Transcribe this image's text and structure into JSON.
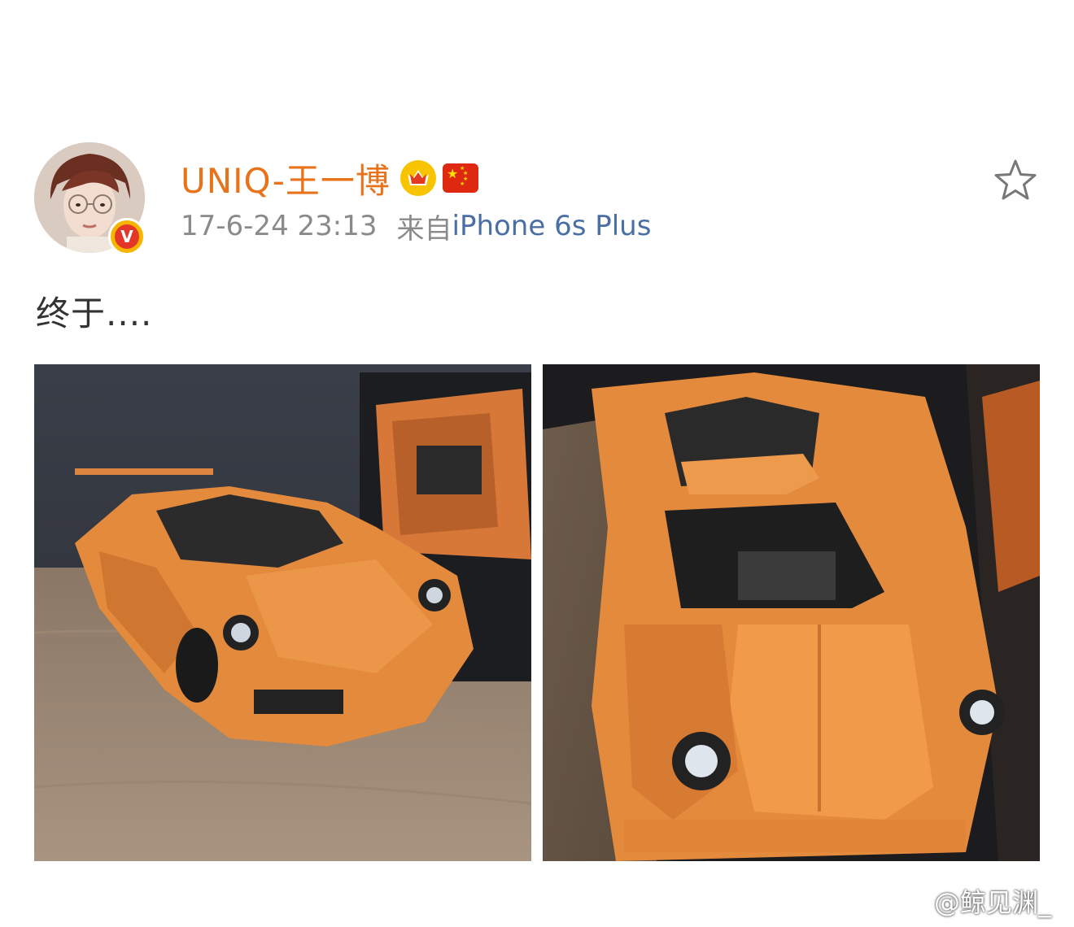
{
  "post": {
    "username": "UNIQ-王一博",
    "timestamp": "17-6-24 23:13",
    "source_prefix": "来自",
    "source_device": "iPhone 6s Plus",
    "text": "终于....",
    "badges": [
      "crown-icon",
      "china-flag-icon"
    ],
    "verified_badge_letter": "V",
    "photo_count": 2
  },
  "watermark": {
    "logo": "weibo-logo-icon",
    "handle": "@鲸见渊_"
  },
  "colors": {
    "username": "#e8731a",
    "meta": "#8a8a8a",
    "source_link": "#4a6fa5",
    "body_text": "#333333",
    "verified_badge": "#f7b500"
  }
}
